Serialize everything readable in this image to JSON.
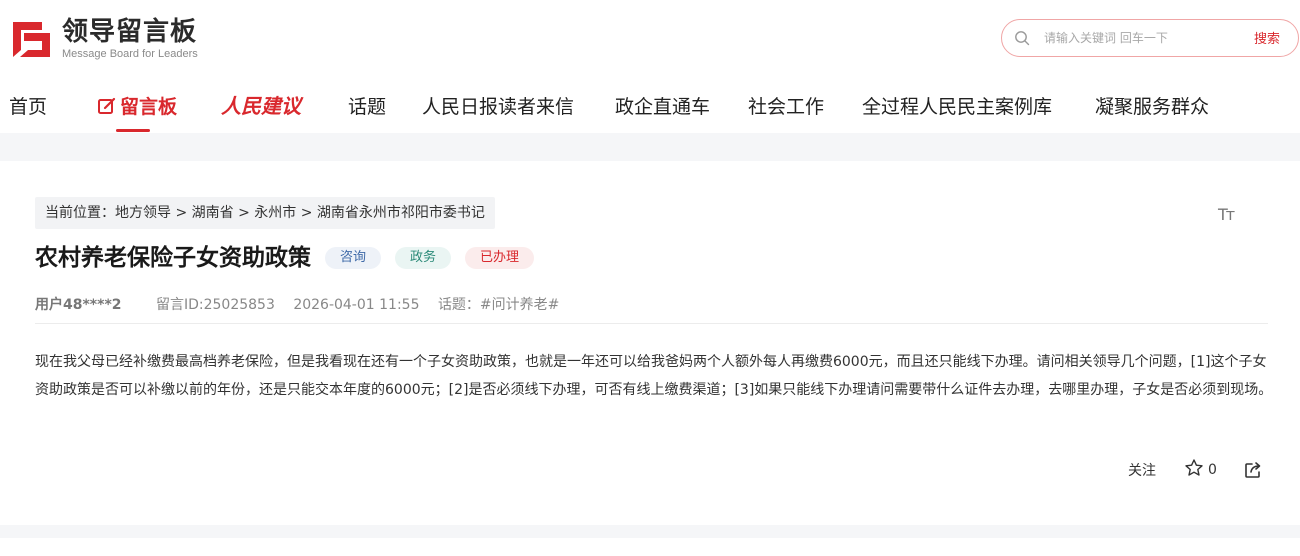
{
  "header": {
    "logo": {
      "title": "领导留言板",
      "subtitle": "Message Board for Leaders"
    },
    "search": {
      "placeholder": "请输入关键词 回车一下",
      "value": "",
      "button_label": "搜索"
    }
  },
  "nav": {
    "items": [
      {
        "label": "首页"
      },
      {
        "label": "留言板",
        "active": true
      },
      {
        "label": "人民建议"
      },
      {
        "label": "话题"
      },
      {
        "label": "人民日报读者来信"
      },
      {
        "label": "政企直通车"
      },
      {
        "label": "社会工作"
      },
      {
        "label": "全过程人民民主案例库"
      },
      {
        "label": "凝聚服务群众"
      }
    ]
  },
  "breadcrumb": {
    "prefix": "当前位置：",
    "items": [
      "地方领导",
      "湖南省",
      "永州市",
      "湖南省永州市祁阳市委书记"
    ],
    "separator": " > "
  },
  "font_toggle": "Tт",
  "post": {
    "title": "农村养老保险子女资助政策",
    "tags": [
      {
        "label": "咨询",
        "color": "#3f6aa8"
      },
      {
        "label": "政务",
        "color": "#2b8a78"
      },
      {
        "label": "已办理",
        "color": "#d9282d"
      }
    ],
    "meta": {
      "user": "用户48****2",
      "message_id": "留言ID:25025853",
      "datetime": "2026-04-01 11:55",
      "topic": "话题：#问计养老#"
    },
    "body": "现在我父母已经补缴费最高档养老保险，但是我看现在还有一个子女资助政策，也就是一年还可以给我爸妈两个人额外每人再缴费6000元，而且还只能线下办理。请问相关领导几个问题，[1]这个子女资助政策是否可以补缴以前的年份，还是只能交本年度的6000元；[2]是否必须线下办理，可否有线上缴费渠道；[3]如果只能线下办理请问需要带什么证件去办理，去哪里办理，子女是否必须到现场。",
    "actions": {
      "follow_label": "关注",
      "like_count": "0"
    }
  },
  "colors": {
    "brand": "#d9282d",
    "background": "#f5f6f8"
  }
}
